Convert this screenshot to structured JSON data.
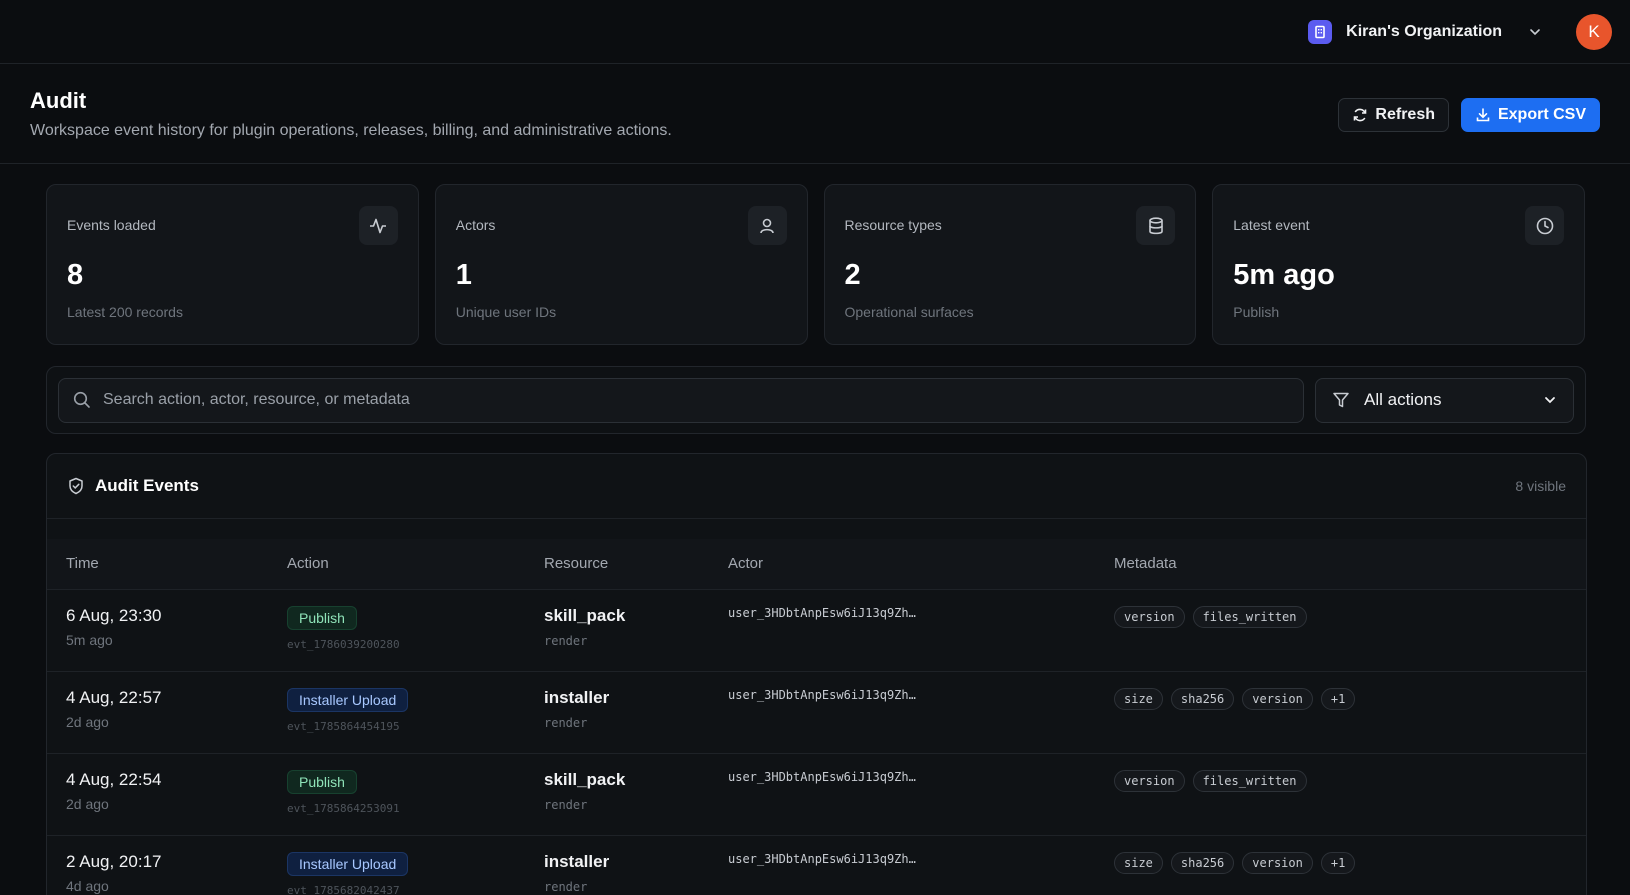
{
  "topbar": {
    "org_name": "Kiran's Organization",
    "avatar_initial": "K"
  },
  "header": {
    "title": "Audit",
    "subtitle": "Workspace event history for plugin operations, releases, billing, and administrative actions.",
    "refresh_label": "Refresh",
    "export_label": "Export CSV"
  },
  "stats": [
    {
      "label": "Events loaded",
      "value": "8",
      "note": "Latest 200 records",
      "icon": "activity-icon"
    },
    {
      "label": "Actors",
      "value": "1",
      "note": "Unique user IDs",
      "icon": "user-icon"
    },
    {
      "label": "Resource types",
      "value": "2",
      "note": "Operational surfaces",
      "icon": "database-icon"
    },
    {
      "label": "Latest event",
      "value": "5m ago",
      "note": "Publish",
      "icon": "clock-icon"
    }
  ],
  "filters": {
    "search_placeholder": "Search action, actor, resource, or metadata",
    "action_filter": "All actions"
  },
  "panel": {
    "title": "Audit Events",
    "count": "8 visible",
    "columns": [
      "Time",
      "Action",
      "Resource",
      "Actor",
      "Metadata"
    ],
    "rows": [
      {
        "time": "6 Aug, 23:30",
        "ago": "5m ago",
        "action": "Publish",
        "action_kind": "publish",
        "event_id": "evt_1786039200280",
        "resource": "skill_pack",
        "resource_sub": "render",
        "actor": "user_3HDbtAnpEsw6iJ13q9Zh…",
        "metadata": [
          "version",
          "files_written"
        ]
      },
      {
        "time": "4 Aug, 22:57",
        "ago": "2d ago",
        "action": "Installer Upload",
        "action_kind": "upload",
        "event_id": "evt_1785864454195",
        "resource": "installer",
        "resource_sub": "render",
        "actor": "user_3HDbtAnpEsw6iJ13q9Zh…",
        "metadata": [
          "size",
          "sha256",
          "version",
          "+1"
        ]
      },
      {
        "time": "4 Aug, 22:54",
        "ago": "2d ago",
        "action": "Publish",
        "action_kind": "publish",
        "event_id": "evt_1785864253091",
        "resource": "skill_pack",
        "resource_sub": "render",
        "actor": "user_3HDbtAnpEsw6iJ13q9Zh…",
        "metadata": [
          "version",
          "files_written"
        ]
      },
      {
        "time": "2 Aug, 20:17",
        "ago": "4d ago",
        "action": "Installer Upload",
        "action_kind": "upload",
        "event_id": "evt_1785682042437",
        "resource": "installer",
        "resource_sub": "render",
        "actor": "user_3HDbtAnpEsw6iJ13q9Zh…",
        "metadata": [
          "size",
          "sha256",
          "version",
          "+1"
        ]
      }
    ]
  }
}
